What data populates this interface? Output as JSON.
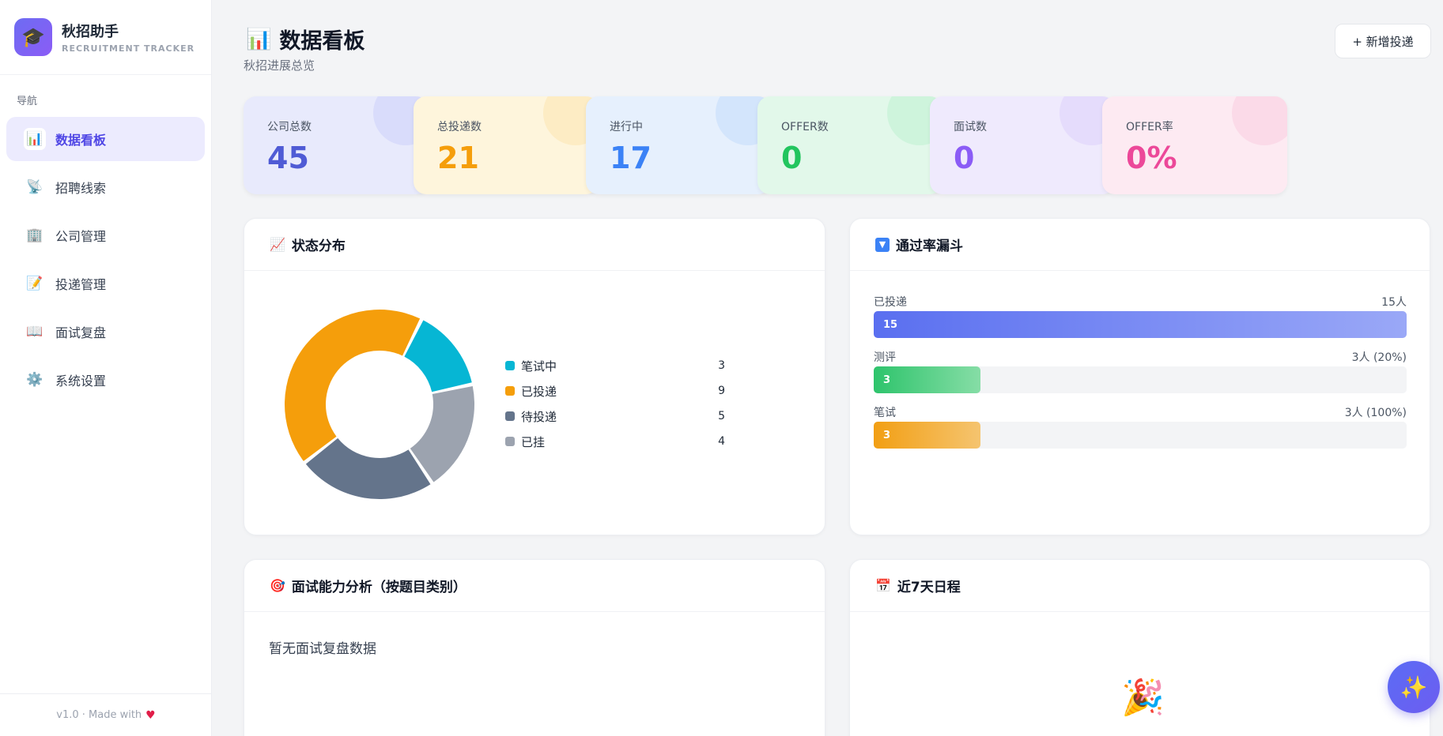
{
  "brand": {
    "name": "秋招助手",
    "subtitle": "RECRUITMENT TRACKER",
    "logo_icon": "graduation-cap-icon"
  },
  "nav": {
    "title": "导航",
    "items": [
      {
        "label": "数据看板",
        "icon": "bar-chart-icon",
        "glyph": "📊",
        "active": true
      },
      {
        "label": "招聘线索",
        "icon": "satellite-dish-icon",
        "glyph": "📡",
        "active": false
      },
      {
        "label": "公司管理",
        "icon": "office-building-icon",
        "glyph": "🏢",
        "active": false
      },
      {
        "label": "投递管理",
        "icon": "memo-icon",
        "glyph": "📝",
        "active": false
      },
      {
        "label": "面试复盘",
        "icon": "open-book-icon",
        "glyph": "📖",
        "active": false
      },
      {
        "label": "系统设置",
        "icon": "gear-icon",
        "glyph": "⚙️",
        "active": false
      }
    ]
  },
  "footer": {
    "text": "v1.0 · Made with",
    "icon": "heart-icon"
  },
  "header": {
    "title": "数据看板",
    "title_icon": "bar-chart-icon",
    "subtitle": "秋招进展总览",
    "add_button": "+ 新增投递"
  },
  "stats": [
    {
      "label": "公司总数",
      "value": "45",
      "color": "#4f5bd5",
      "bg": "#e8eafc",
      "circle": "#c7cdfa"
    },
    {
      "label": "总投递数",
      "value": "21",
      "color": "#f59e0b",
      "bg": "#fef5dc",
      "circle": "#fde3a7"
    },
    {
      "label": "进行中",
      "value": "17",
      "color": "#3b82f6",
      "bg": "#e6f0fd",
      "circle": "#bcd6fb"
    },
    {
      "label": "OFFER数",
      "value": "0",
      "color": "#22c55e",
      "bg": "#e2f8ea",
      "circle": "#b6efcb"
    },
    {
      "label": "面试数",
      "value": "0",
      "color": "#8b5cf6",
      "bg": "#efeafd",
      "circle": "#d9cbfb"
    },
    {
      "label": "OFFER率",
      "value": "0%",
      "color": "#ec4899",
      "bg": "#fdeaf2",
      "circle": "#f9c7dc"
    }
  ],
  "status_card": {
    "title": "状态分布",
    "icon": "chart-increasing-icon",
    "chart_data": {
      "type": "pie",
      "categories": [
        "笔试中",
        "已投递",
        "待投递",
        "已挂"
      ],
      "values": [
        3,
        9,
        5,
        4
      ],
      "colors": [
        "#06b6d4",
        "#f59e0b",
        "#64748b",
        "#9ca3af"
      ]
    }
  },
  "funnel_card": {
    "title": "通过率漏斗",
    "icon": "down-triangle-icon",
    "rows": [
      {
        "label": "已投递",
        "value": "15",
        "right": "15人",
        "fraction": 1.0,
        "gradient": [
          "#5a6ff0",
          "#9aa8f7"
        ]
      },
      {
        "label": "测评",
        "value": "3",
        "right": "3人 (20%)",
        "fraction": 0.2,
        "gradient": [
          "#2ec46c",
          "#86dda6"
        ]
      },
      {
        "label": "笔试",
        "value": "3",
        "right": "3人 (100%)",
        "fraction": 0.2,
        "gradient": [
          "#f29f14",
          "#f5c46f"
        ]
      }
    ]
  },
  "interview_card": {
    "title": "面试能力分析（按题目类别）",
    "icon": "target-icon",
    "empty": "暂无面试复盘数据"
  },
  "schedule_card": {
    "title": "近7天日程",
    "icon": "calendar-icon",
    "empty_icon": "party-popper-icon"
  },
  "fab": {
    "icon": "sparkles-icon"
  }
}
